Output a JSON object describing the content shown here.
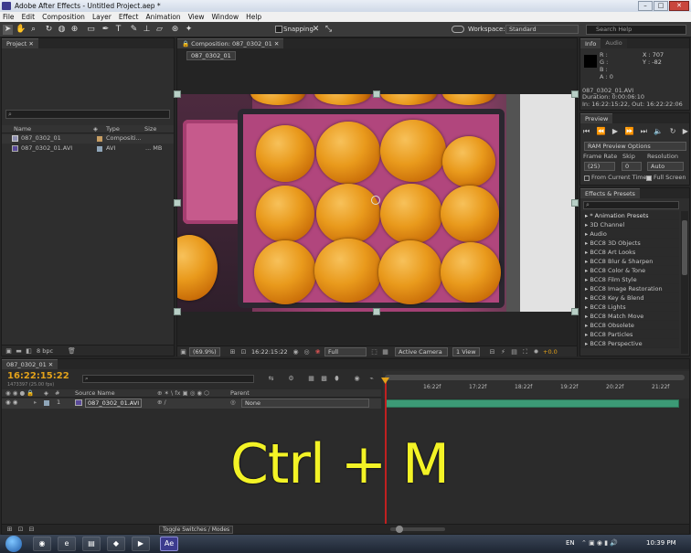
{
  "window": {
    "title": "Adobe After Effects - Untitled Project.aep *",
    "min": "–",
    "max": "□",
    "close": "✕"
  },
  "menu": [
    "File",
    "Edit",
    "Composition",
    "Layer",
    "Effect",
    "Animation",
    "View",
    "Window",
    "Help"
  ],
  "toolbar": {
    "snapping": "Snapping",
    "workspace_label": "Workspace:",
    "workspace_value": "Standard",
    "search_placeholder": "Search Help"
  },
  "project": {
    "tab": "Project",
    "search_icon": "⌕",
    "columns": {
      "name": "Name",
      "type": "Type",
      "size": "Size"
    },
    "items": [
      {
        "name": "087_0302_01",
        "type": "Compositi...",
        "size": ""
      },
      {
        "name": "087_0302_01.AVI",
        "type": "AVI",
        "size": "... MB"
      }
    ],
    "bpc": "8 bpc"
  },
  "comp": {
    "tab": "Composition: 087_0302_01",
    "subtab": "087_0302_01",
    "zoom": "(69.9%)",
    "timecode": "16:22:15:22",
    "quality": "Full",
    "camera": "Active Camera",
    "views": "1 View",
    "exposure": "+0.0"
  },
  "info": {
    "tabs": [
      "Info",
      "Audio"
    ],
    "r": "R :",
    "g": "G :",
    "b": "B :",
    "a": "A : 0",
    "x": "X : 707",
    "y": "Y : -82",
    "file": "087_0302_01.AVI",
    "duration": "Duration: 0:00:06:10",
    "inout": "In: 16:22:15:22, Out: 16:22:22:06"
  },
  "preview": {
    "tab": "Preview",
    "ram": "RAM Preview Options",
    "frame_rate_label": "Frame Rate",
    "skip_label": "Skip",
    "resolution_label": "Resolution",
    "frame_rate": "(25)",
    "skip": "0",
    "resolution": "Auto",
    "from_current": "From Current Time",
    "full_screen": "Full Screen"
  },
  "effects": {
    "tab": "Effects & Presets",
    "items": [
      "* Animation Presets",
      "3D Channel",
      "Audio",
      "BCC8 3D Objects",
      "BCC8 Art Looks",
      "BCC8 Blur & Sharpen",
      "BCC8 Color & Tone",
      "BCC8 Film Style",
      "BCC8 Image Restoration",
      "BCC8 Key & Blend",
      "BCC8 Lights",
      "BCC8 Match Move",
      "BCC8 Obsolete",
      "BCC8 Particles",
      "BCC8 Perspective"
    ]
  },
  "timeline": {
    "tab": "087_0302_01",
    "timecode": "16:22:15:22",
    "fps": "1473397 (25.00 fps)",
    "col_source": "Source Name",
    "col_parent": "Parent",
    "layer_num": "1",
    "layer_name": "087_0302_01.AVI",
    "parent_value": "None",
    "ticks": [
      "16:22f",
      "17:22f",
      "18:22f",
      "19:22f",
      "20:22f",
      "21:22f"
    ],
    "toggle": "Toggle Switches / Modes"
  },
  "overlay_text": "Ctrl + M",
  "taskbar": {
    "lang": "EN",
    "time": "10:39 PM"
  },
  "colors": {
    "accent_time": "#e3a21a",
    "track": "#3c9a76",
    "overlay": "#f3f326",
    "playhead": "#c02020"
  }
}
